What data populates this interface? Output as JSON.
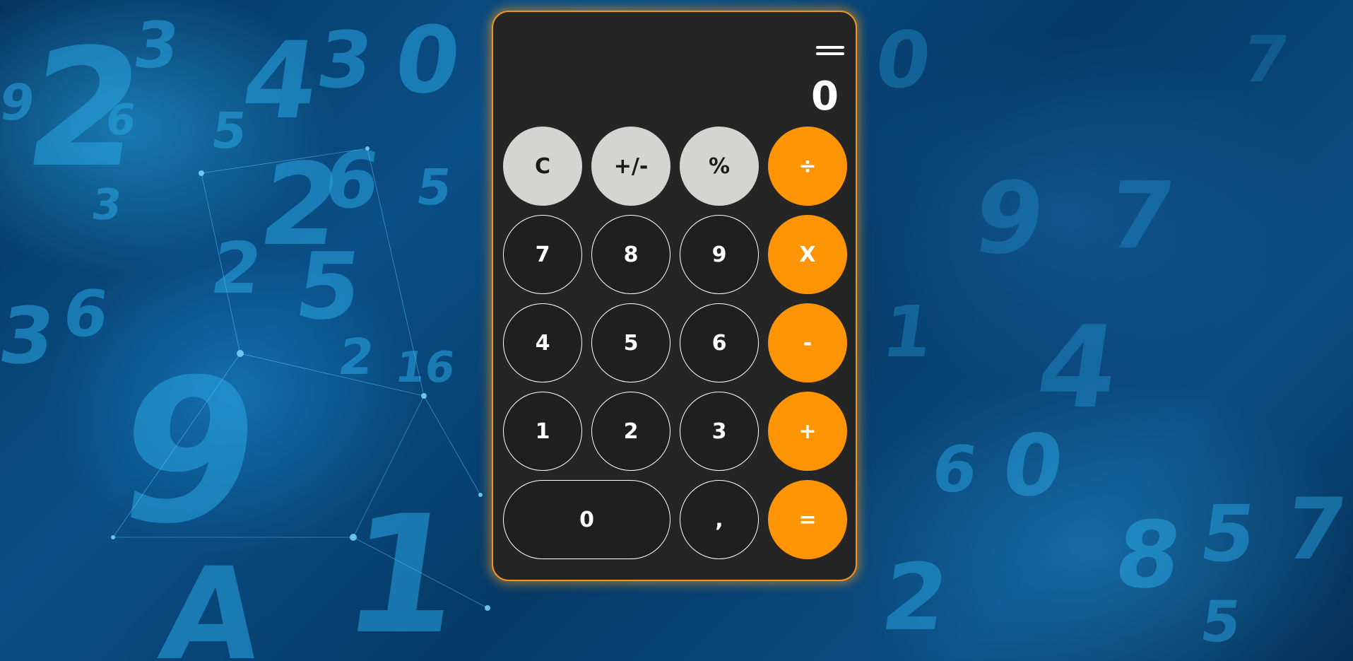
{
  "display": {
    "value": "0"
  },
  "keys": {
    "clear": "C",
    "sign": "+/-",
    "percent": "%",
    "divide": "÷",
    "seven": "7",
    "eight": "8",
    "nine": "9",
    "multiply": "X",
    "four": "4",
    "five": "5",
    "six": "6",
    "subtract": "-",
    "one": "1",
    "two": "2",
    "three": "3",
    "add": "+",
    "zero": "0",
    "decimal": ",",
    "equals": "="
  },
  "colors": {
    "accent": "#ff9505",
    "function_key": "#d4d4d2",
    "number_key": "#1f1f1f",
    "panel": "#252525",
    "background": "#0a4f86"
  },
  "icons": {
    "menu": "hamburger-menu-icon"
  }
}
